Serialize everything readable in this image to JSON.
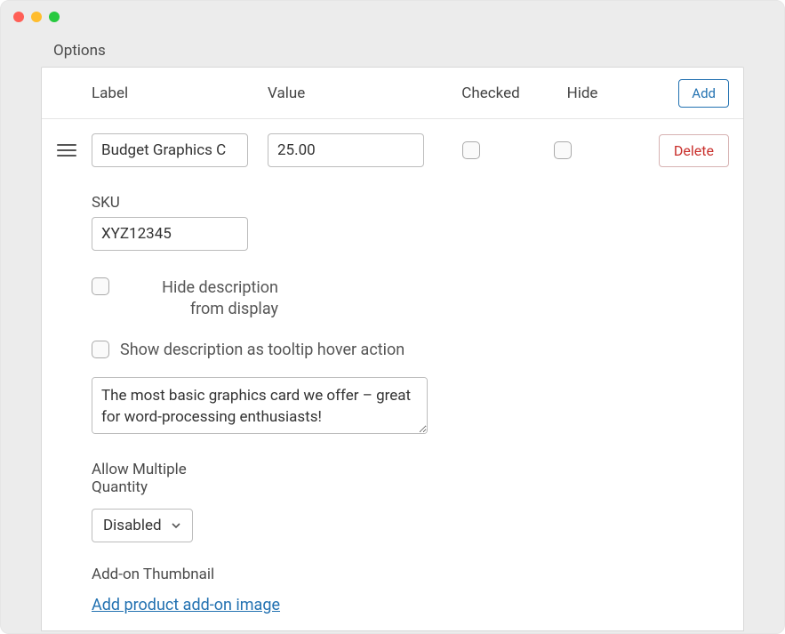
{
  "section_title": "Options",
  "columns": {
    "label": "Label",
    "value": "Value",
    "checked": "Checked",
    "hide": "Hide"
  },
  "buttons": {
    "add": "Add",
    "delete": "Delete"
  },
  "row": {
    "label": "Budget Graphics C",
    "value": "25.00"
  },
  "sku": {
    "label": "SKU",
    "value": "XYZ12345"
  },
  "hide_description": "Hide description from display",
  "tooltip_option": "Show description as tooltip hover action",
  "description": "The most basic graphics card we offer – great for word-processing enthusiasts!",
  "allow_multiple": {
    "label": "Allow Multiple Quantity",
    "value": "Disabled"
  },
  "thumbnail": {
    "label": "Add-on Thumbnail",
    "link": "Add product add-on image"
  }
}
